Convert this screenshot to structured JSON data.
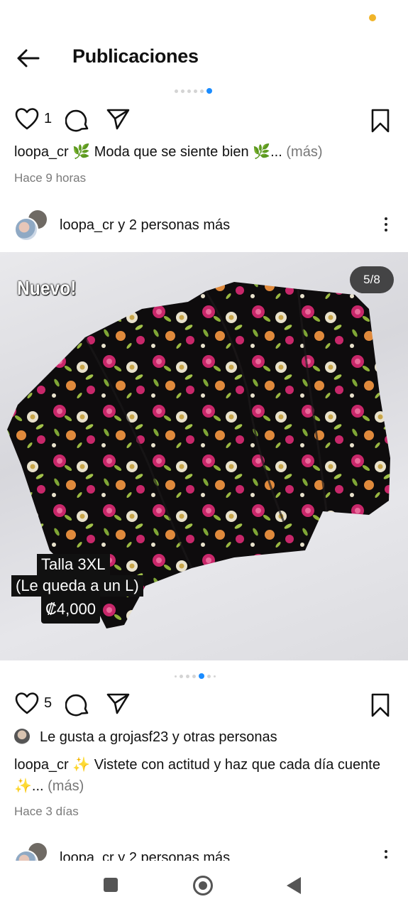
{
  "header": {
    "title": "Publicaciones"
  },
  "post1": {
    "likes": "1",
    "username": "loopa_cr",
    "caption_text": "🌿 Moda que se siente bien 🌿...",
    "more_label": "(más)",
    "time": "Hace 9 horas"
  },
  "post2": {
    "author_label": "loopa_cr y 2 personas más",
    "image_counter": "5/8",
    "image_texts": {
      "tag": "Nuevo!",
      "size": "Talla 3XL",
      "fit": "(Le queda a un L)",
      "price": "₡4,000"
    },
    "likes": "5",
    "liked_by": "Le gusta a grojasf23 y otras personas",
    "username": "loopa_cr",
    "caption_text": "✨ Vistete con actitud y haz que cada día cuente ✨...",
    "more_label": "(más)",
    "time": "Hace 3 días"
  },
  "post3": {
    "author_label": "loopa_cr y 2 personas más"
  },
  "icons": {
    "back": "arrow-left-icon",
    "like": "heart-outline-icon",
    "comment": "comment-bubble-icon",
    "share": "paper-plane-icon",
    "save": "bookmark-icon",
    "menu": "vertical-dots-icon"
  },
  "colors": {
    "accent": "#1a8cff",
    "text": "#111111",
    "muted": "#7a7a7a"
  }
}
